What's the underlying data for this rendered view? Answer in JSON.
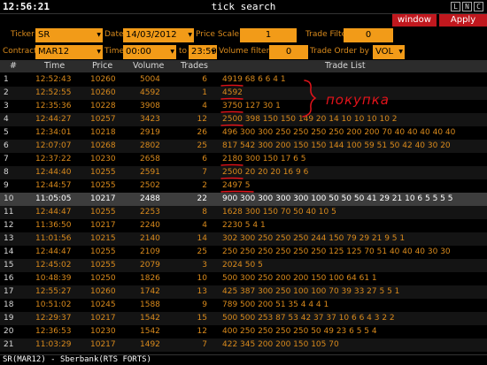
{
  "window": {
    "clock": "12:56:21",
    "title": "tick search",
    "controls": [
      "L",
      "N",
      "C"
    ]
  },
  "menu": {
    "window_label": "window",
    "apply_label": "Apply"
  },
  "filters": {
    "ticker_label": "Ticker",
    "ticker_value": "SR",
    "date_label": "Date",
    "date_value": "14/03/2012",
    "price_scale_label": "Price Scale",
    "price_scale_value": "1",
    "trade_filter_label": "Trade Filter",
    "trade_filter_value": "0",
    "contract_label": "Contract",
    "contract_value": "MAR12",
    "time_label": "Time",
    "time_from": "00:00",
    "to_label": "to",
    "time_to": "23:59",
    "volume_filter_label": "Volume filter",
    "volume_filter_value": "0",
    "trade_order_label": "Trade Order by",
    "trade_order_value": "VOL"
  },
  "columns": {
    "num": "#",
    "time": "Time",
    "price": "Price",
    "volume": "Volume",
    "trades": "Trades",
    "list": "Trade List"
  },
  "rows": [
    {
      "n": "1",
      "time": "12:52:43",
      "price": "10260",
      "volume": "5004",
      "trades": "6",
      "list": "4919  68  6  6  4  1"
    },
    {
      "n": "2",
      "time": "12:52:55",
      "price": "10260",
      "volume": "4592",
      "trades": "1",
      "list": "4592"
    },
    {
      "n": "3",
      "time": "12:35:36",
      "price": "10228",
      "volume": "3908",
      "trades": "4",
      "list": "3750  127  30  1"
    },
    {
      "n": "4",
      "time": "12:44:27",
      "price": "10257",
      "volume": "3423",
      "trades": "12",
      "list": "2500  398  150  150  149  20  14  10  10  10  10  2"
    },
    {
      "n": "5",
      "time": "12:34:01",
      "price": "10218",
      "volume": "2919",
      "trades": "26",
      "list": "496  300  300  250  250  250  250  200  200  70  40  40  40  40  40"
    },
    {
      "n": "6",
      "time": "12:07:07",
      "price": "10268",
      "volume": "2802",
      "trades": "25",
      "list": "817  542  300  200  150  150  144  100  59  51  50  42  40  30  20"
    },
    {
      "n": "7",
      "time": "12:37:22",
      "price": "10230",
      "volume": "2658",
      "trades": "6",
      "list": "2180  300  150  17  6  5"
    },
    {
      "n": "8",
      "time": "12:44:40",
      "price": "10255",
      "volume": "2591",
      "trades": "7",
      "list": "2500  20  20  20  16  9  6"
    },
    {
      "n": "9",
      "time": "12:44:57",
      "price": "10255",
      "volume": "2502",
      "trades": "2",
      "list": "2497  5"
    },
    {
      "n": "10",
      "time": "11:05:05",
      "price": "10217",
      "volume": "2488",
      "trades": "22",
      "list": "900  300  300  300  300  100  50  50  50  41  29  21  10  6  5  5  5  5"
    },
    {
      "n": "11",
      "time": "12:44:47",
      "price": "10255",
      "volume": "2253",
      "trades": "8",
      "list": "1628  300  150  70  50  40  10  5"
    },
    {
      "n": "12",
      "time": "11:36:50",
      "price": "10217",
      "volume": "2240",
      "trades": "4",
      "list": "2230  5  4  1"
    },
    {
      "n": "13",
      "time": "11:01:56",
      "price": "10215",
      "volume": "2140",
      "trades": "14",
      "list": "302  300  250  250  250  244  150  79  29  21  9  5  1"
    },
    {
      "n": "14",
      "time": "12:44:47",
      "price": "10255",
      "volume": "2109",
      "trades": "25",
      "list": "250  250  250  250  250  250  125  125  70  51  40  40  40  30  30"
    },
    {
      "n": "15",
      "time": "12:45:02",
      "price": "10255",
      "volume": "2079",
      "trades": "3",
      "list": "2024  50  5"
    },
    {
      "n": "16",
      "time": "10:48:39",
      "price": "10250",
      "volume": "1826",
      "trades": "10",
      "list": "500  300  250  200  200  150  100  64  61  1"
    },
    {
      "n": "17",
      "time": "12:55:27",
      "price": "10260",
      "volume": "1742",
      "trades": "13",
      "list": "425  387  300  250  100  100  70  39  33  27  5  5  1"
    },
    {
      "n": "18",
      "time": "10:51:02",
      "price": "10245",
      "volume": "1588",
      "trades": "9",
      "list": "789  500  200  51  35  4  4  4  1"
    },
    {
      "n": "19",
      "time": "12:29:37",
      "price": "10217",
      "volume": "1542",
      "trades": "15",
      "list": "500  500  253  87  53  42  37  37  10  6  6  4  3  2  2"
    },
    {
      "n": "20",
      "time": "12:36:53",
      "price": "10230",
      "volume": "1542",
      "trades": "12",
      "list": "400  250  250  250  250  50  49  23  6  5  5  4"
    },
    {
      "n": "21",
      "time": "11:03:29",
      "price": "10217",
      "volume": "1492",
      "trades": "7",
      "list": "422  345  200  200  150  105  70"
    }
  ],
  "status": {
    "text": "SR(MAR12) - Sberbank(RTS FORTS)"
  },
  "annotation": {
    "text": "покупка",
    "color": "#e1131a"
  },
  "colors": {
    "accent": "#f29b18",
    "menu_red": "#c0181e",
    "text_orange": "#d98a1c",
    "header_bg": "#2c2c2c"
  }
}
